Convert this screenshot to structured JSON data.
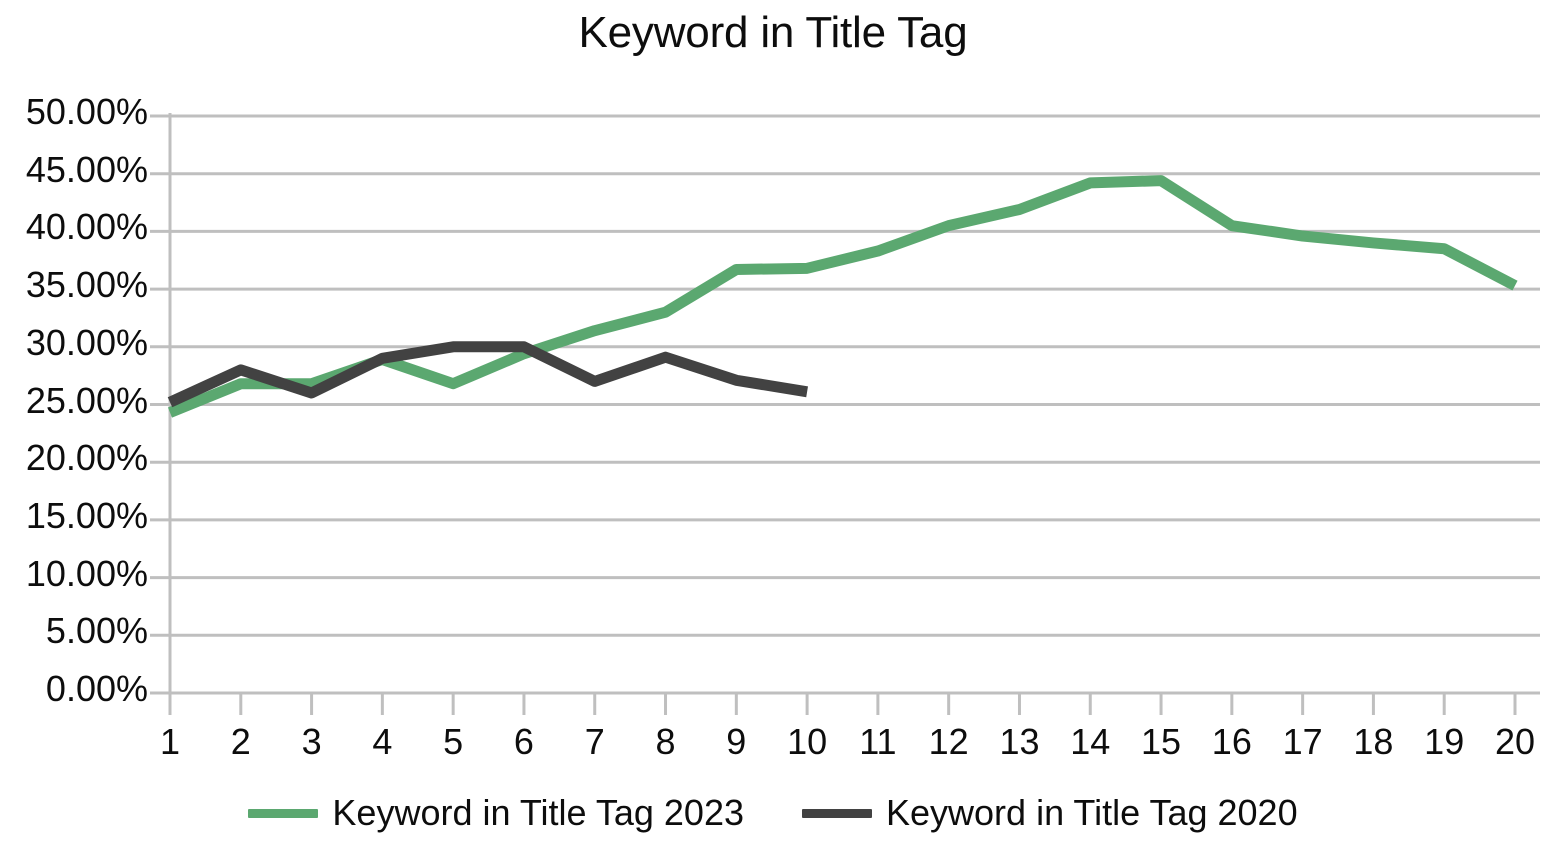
{
  "chart_data": {
    "type": "line",
    "title": "Keyword in Title Tag",
    "xlabel": "",
    "ylabel": "",
    "x": [
      1,
      2,
      3,
      4,
      5,
      6,
      7,
      8,
      9,
      10,
      11,
      12,
      13,
      14,
      15,
      16,
      17,
      18,
      19,
      20
    ],
    "xtick_labels": [
      "1",
      "2",
      "3",
      "4",
      "5",
      "6",
      "7",
      "8",
      "9",
      "10",
      "11",
      "12",
      "13",
      "14",
      "15",
      "16",
      "17",
      "18",
      "19",
      "20"
    ],
    "ytick_labels": [
      "0.00%",
      "5.00%",
      "10.00%",
      "15.00%",
      "20.00%",
      "25.00%",
      "30.00%",
      "35.00%",
      "40.00%",
      "45.00%",
      "50.00%"
    ],
    "ytick_values": [
      0,
      5,
      10,
      15,
      20,
      25,
      30,
      35,
      40,
      45,
      50
    ],
    "ylim": [
      0,
      50
    ],
    "xlim": [
      1,
      20
    ],
    "grid": "horizontal",
    "legend_position": "bottom",
    "series": [
      {
        "name": "Keyword in Title Tag 2023",
        "color": "#5BA870",
        "values": [
          24.3,
          26.8,
          26.8,
          28.9,
          26.8,
          29.4,
          31.4,
          33.0,
          36.7,
          36.8,
          38.3,
          40.5,
          41.9,
          44.2,
          44.4,
          40.5,
          39.6,
          39.0,
          38.5,
          35.3
        ]
      },
      {
        "name": "Keyword in Title Tag 2020",
        "color": "#424242",
        "values": [
          25.2,
          28.0,
          26.0,
          29.0,
          30.0,
          30.0,
          27.0,
          29.1,
          27.1,
          26.1,
          null,
          null,
          null,
          null,
          null,
          null,
          null,
          null,
          null,
          null
        ]
      }
    ]
  },
  "legend": {
    "items": [
      {
        "label": "Keyword in Title Tag 2023",
        "color": "#5BA870"
      },
      {
        "label": "Keyword in Title Tag 2020",
        "color": "#424242"
      }
    ]
  },
  "colors": {
    "series_2023": "#5BA870",
    "series_2020": "#424242",
    "gridline": "#bfbfbf",
    "axis": "#bfbfbf",
    "text": "#0d0d0d",
    "background": "#ffffff"
  }
}
